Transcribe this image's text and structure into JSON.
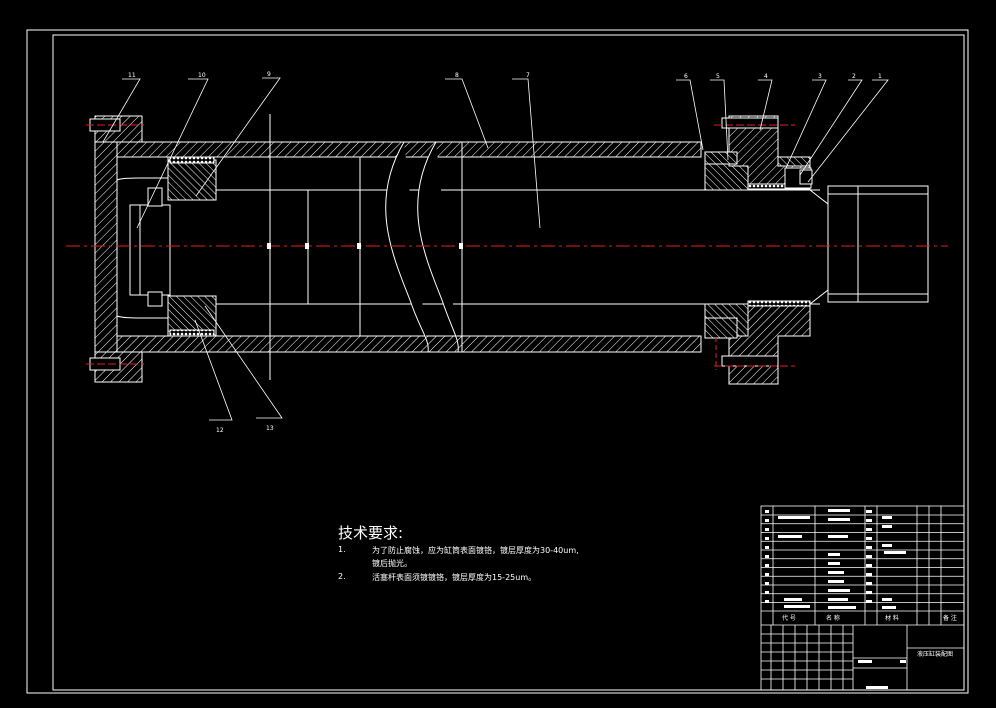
{
  "drawing": {
    "part_numbers": [
      "1",
      "2",
      "3",
      "4",
      "5",
      "6",
      "7",
      "8",
      "9",
      "10",
      "11",
      "12",
      "13"
    ],
    "background_color": "#000000",
    "line_color": "#ffffff",
    "centerline_color": "#e02020"
  },
  "tech_requirements": {
    "title": "技术要求:",
    "items": [
      {
        "num": "1.",
        "text": "为了防止腐蚀，应为缸筒表面镀铬，镀层厚度为30-40um,"
      },
      {
        "num": "",
        "text": "镀后抛光。"
      },
      {
        "num": "2.",
        "text": "活塞杆表面须镀镀铬，镀层厚度为15-25um。"
      }
    ]
  },
  "title_block": {
    "col_code": "代  号",
    "col_name": "名  称",
    "col_material": "材  料",
    "col_remark": "备 注",
    "drawing_title": "液压缸装配图"
  }
}
